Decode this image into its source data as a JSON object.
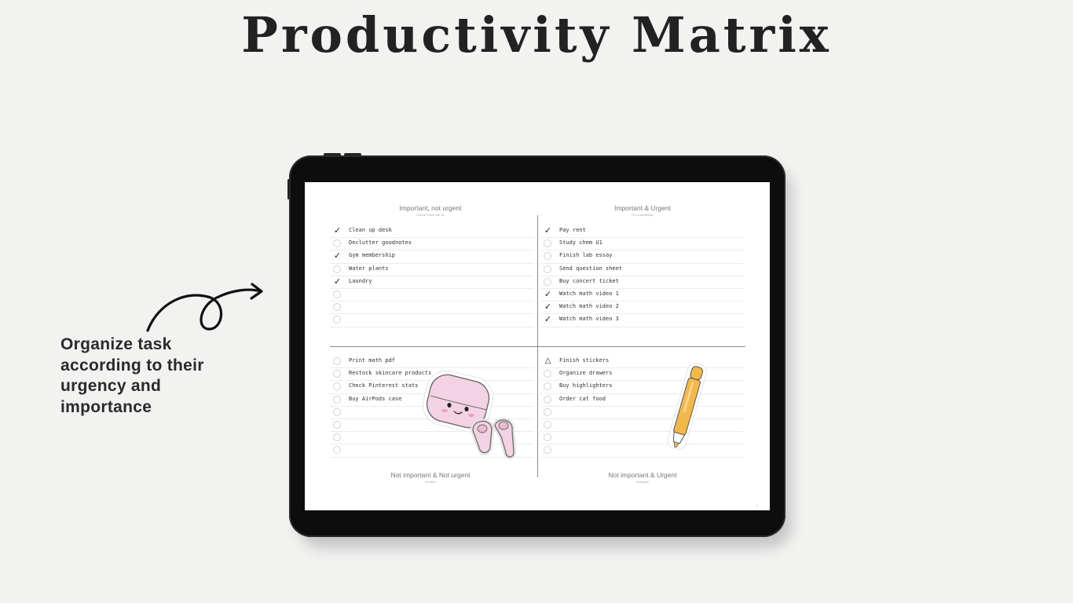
{
  "title": "Productivity Matrix",
  "side_caption": {
    "lines": [
      "Organize task",
      "according to their",
      "urgency and",
      "importance"
    ]
  },
  "quadrants": {
    "important_not_urgent": {
      "title": "Important, not urgent",
      "subtitle": "Decide when will do",
      "tasks": [
        {
          "mark": "check",
          "text": "Clean up desk"
        },
        {
          "mark": "empty",
          "text": "Declutter goodnotes"
        },
        {
          "mark": "check",
          "text": "Gym membership"
        },
        {
          "mark": "empty",
          "text": "Water plants"
        },
        {
          "mark": "check",
          "text": "Laundry"
        },
        {
          "mark": "empty",
          "text": ""
        },
        {
          "mark": "empty",
          "text": ""
        },
        {
          "mark": "empty",
          "text": ""
        }
      ]
    },
    "important_urgent": {
      "title": "Important & Urgent",
      "subtitle": "Do immediately",
      "tasks": [
        {
          "mark": "check",
          "text": "Pay rent"
        },
        {
          "mark": "empty",
          "text": "Study chem U1"
        },
        {
          "mark": "empty",
          "text": "Finish lab essay"
        },
        {
          "mark": "empty",
          "text": "Send question sheet"
        },
        {
          "mark": "empty",
          "text": "Buy concert ticket"
        },
        {
          "mark": "check",
          "text": "Watch math video 1"
        },
        {
          "mark": "check",
          "text": "Watch math video 2"
        },
        {
          "mark": "check",
          "text": "Watch math video 3"
        }
      ]
    },
    "not_important_not_urgent": {
      "title": "Not important & Not urgent",
      "subtitle": "Do later",
      "tasks": [
        {
          "mark": "empty",
          "text": "Print math pdf"
        },
        {
          "mark": "empty",
          "text": "Restock skincare products"
        },
        {
          "mark": "empty",
          "text": "Check Pinterest stats"
        },
        {
          "mark": "empty",
          "text": "Buy AirPods case"
        },
        {
          "mark": "empty",
          "text": ""
        },
        {
          "mark": "empty",
          "text": ""
        },
        {
          "mark": "empty",
          "text": ""
        },
        {
          "mark": "empty",
          "text": ""
        }
      ]
    },
    "not_important_urgent": {
      "title": "Not important & Urgent",
      "subtitle": "Delegate",
      "tasks": [
        {
          "mark": "triangle",
          "text": "Finish stickers"
        },
        {
          "mark": "empty",
          "text": "Organize drawers"
        },
        {
          "mark": "empty",
          "text": "Buy highlighters"
        },
        {
          "mark": "empty",
          "text": "Order cat food"
        },
        {
          "mark": "empty",
          "text": ""
        },
        {
          "mark": "empty",
          "text": ""
        },
        {
          "mark": "empty",
          "text": ""
        },
        {
          "mark": "empty",
          "text": ""
        }
      ]
    }
  },
  "icons": {
    "check": "✓",
    "triangle": "△",
    "stickers": [
      "airpods-case-sticker",
      "airpods-sticker",
      "highlighter-pen-sticker"
    ],
    "arrow": "curly-arrow-icon"
  },
  "colors": {
    "background": "#f2f2f1",
    "tablet_frame": "#0d0d0d",
    "sticker_pink": "#f3d3e3",
    "sticker_yellow": "#f2b84a"
  }
}
